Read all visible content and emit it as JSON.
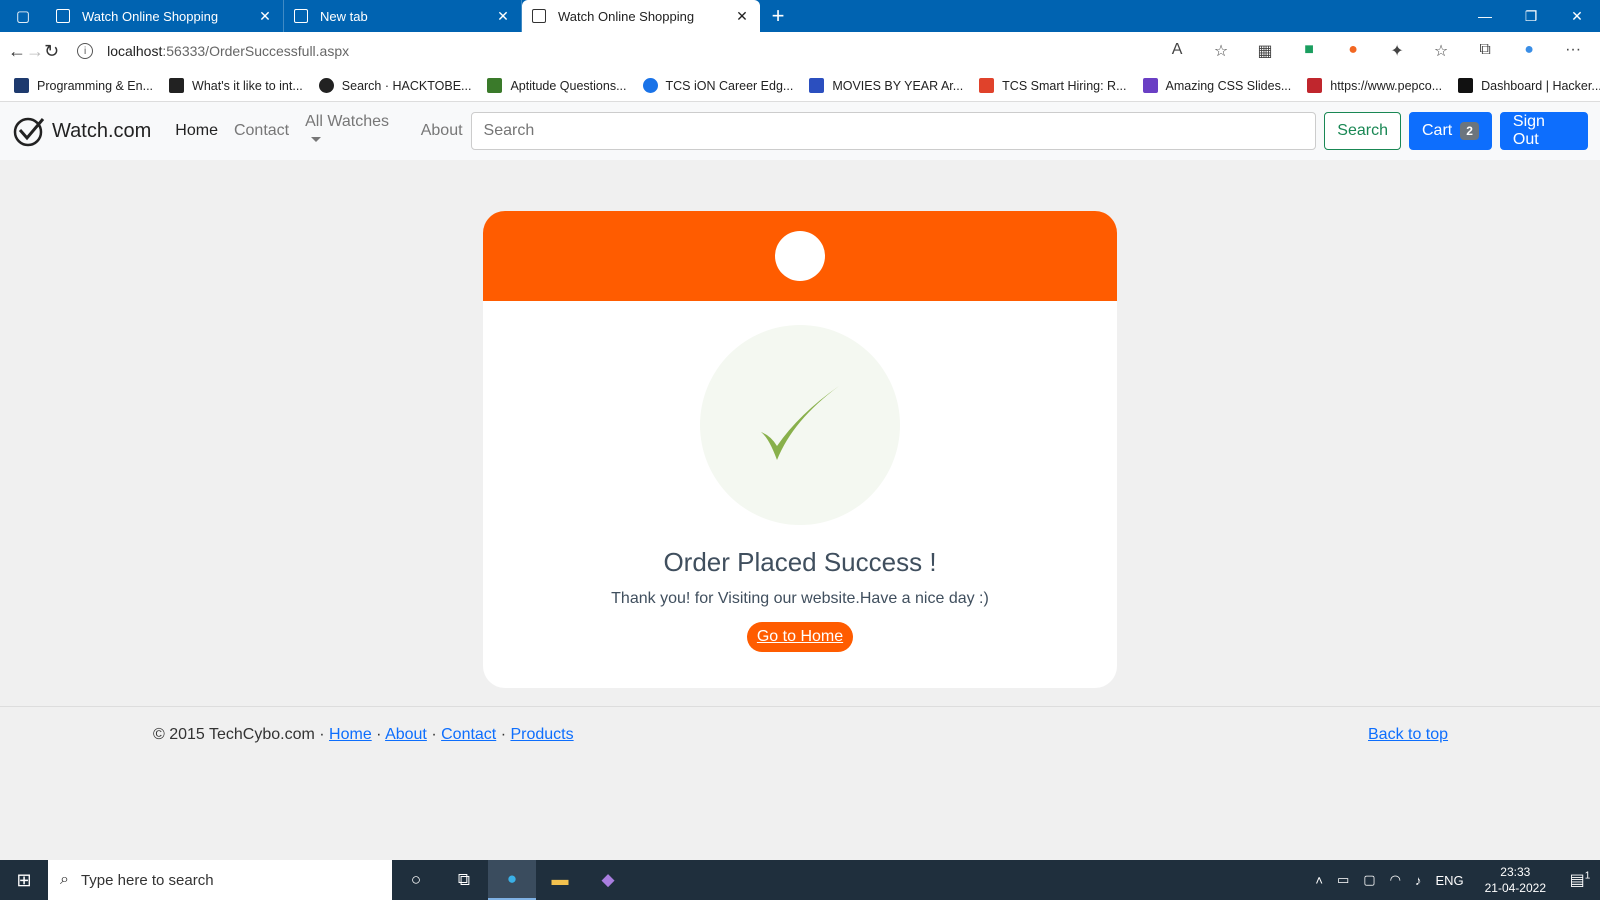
{
  "browser": {
    "tabs": [
      {
        "title": "Watch Online Shopping",
        "active": false
      },
      {
        "title": "New tab",
        "active": false
      },
      {
        "title": "Watch Online Shopping",
        "active": true
      }
    ],
    "url_host": "localhost",
    "url_path": ":56333/OrderSuccessfull.aspx",
    "bookmarks": [
      {
        "label": "Programming & En...",
        "color": "#1e3a6e"
      },
      {
        "label": "What's it like to int...",
        "color": "#222222"
      },
      {
        "label": "Search · HACKTOBE...",
        "color": "#222222"
      },
      {
        "label": "Aptitude Questions...",
        "color": "#3a7a2a"
      },
      {
        "label": "TCS iON Career Edg...",
        "color": "#1a73e8"
      },
      {
        "label": "MOVIES BY YEAR Ar...",
        "color": "#2b4fbf"
      },
      {
        "label": "TCS Smart Hiring: R...",
        "color": "#e0422b"
      },
      {
        "label": "Amazing CSS Slides...",
        "color": "#6a3fc4"
      },
      {
        "label": "https://www.pepco...",
        "color": "#c0262d"
      },
      {
        "label": "Dashboard | Hacker...",
        "color": "#111111"
      }
    ]
  },
  "site": {
    "brand": "Watch.com",
    "nav": {
      "home": "Home",
      "contact": "Contact",
      "all_watches": "All Watches",
      "about": "About"
    },
    "search_placeholder": "Search",
    "search_button": "Search",
    "cart_label": "Cart",
    "cart_count": "2",
    "signout_label": "Sign Out"
  },
  "order": {
    "title": "Order Placed Success !",
    "message": "Thank you! for Visiting our website.Have a nice day :)",
    "home_button": "Go to Home",
    "accent": "#ff5c00",
    "check_color": "#88b04b"
  },
  "footer": {
    "copyright": "© 2015 TechCybo.com ·",
    "links": {
      "home": "Home",
      "about": "About",
      "contact": "Contact",
      "products": "Products"
    },
    "sep": "·",
    "back_to_top": "Back to top"
  },
  "taskbar": {
    "search_placeholder": "Type here to search",
    "lang": "ENG",
    "time": "23:33",
    "date": "21-04-2022",
    "notif_count": "1"
  }
}
